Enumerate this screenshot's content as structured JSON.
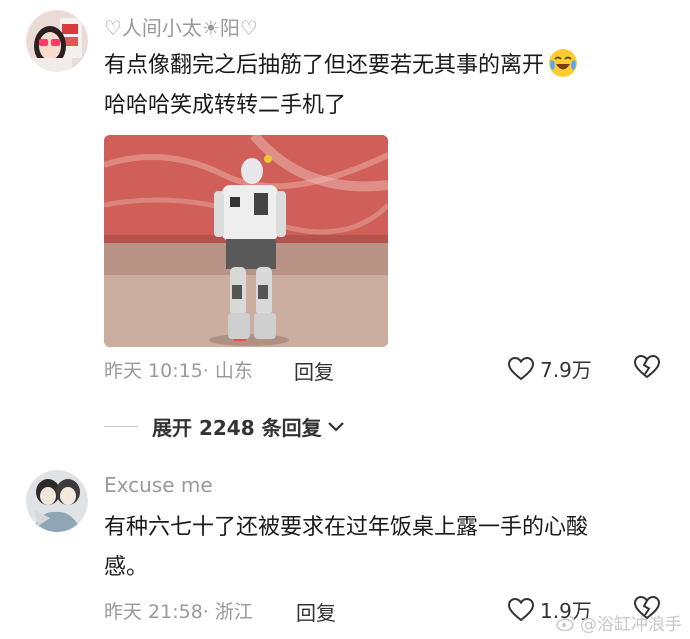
{
  "comments": [
    {
      "username": "♡人间小太☀阳♡",
      "text_line1": "有点像翻完之后抽筋了但还要若无其事的离开",
      "text_line2": "哈哈哈笑成转转二手机了",
      "time": "昨天 10:15",
      "location": "· 山东",
      "reply_label": "回复",
      "likes": "7.9万",
      "emoji": "crying-laughing-emoji",
      "avatar_icon": "user-avatar-girl-heart-glasses"
    },
    {
      "username": "Excuse me",
      "text_line1": "有种六七十了还被要求在过年饭桌上露一手的心酸",
      "text_line2": "感。",
      "time": "昨天 21:58",
      "location": "· 浙江",
      "reply_label": "回复",
      "likes": "1.9万",
      "avatar_icon": "user-avatar-illustrated-pair"
    }
  ],
  "expand_replies": {
    "label": "展开 2248 条回复"
  },
  "watermark": "@浴缸冲浪手",
  "colors": {
    "meta": "#9a9a9a",
    "text": "#1a1a1a",
    "image_bg": "#c9534f"
  }
}
